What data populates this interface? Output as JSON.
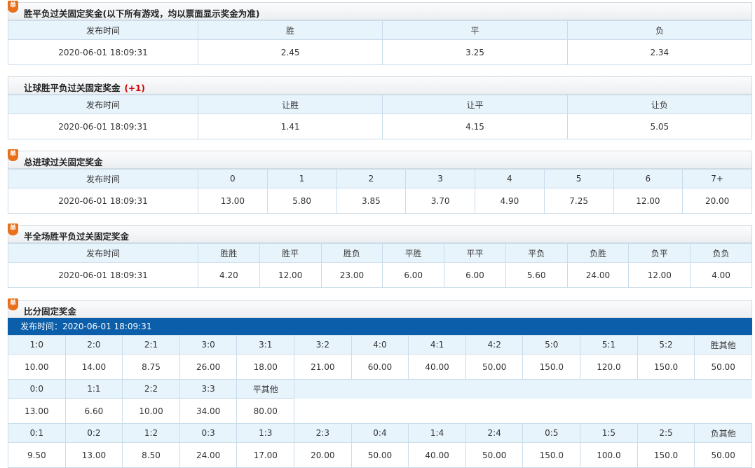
{
  "sections": {
    "s1": {
      "badge": "单",
      "title": "胜平负过关固定奖金(以下所有游戏，均以票面显示奖金为准)",
      "headers": [
        "发布时间",
        "胜",
        "平",
        "负"
      ],
      "values": [
        "2020-06-01 18:09:31",
        "2.45",
        "3.25",
        "2.34"
      ]
    },
    "s2": {
      "title": "让球胜平负过关固定奖金",
      "handicap": "(+1)",
      "headers": [
        "发布时间",
        "让胜",
        "让平",
        "让负"
      ],
      "values": [
        "2020-06-01 18:09:31",
        "1.41",
        "4.15",
        "5.05"
      ]
    },
    "s3": {
      "badge": "单",
      "title": "总进球过关固定奖金",
      "headers": [
        "发布时间",
        "0",
        "1",
        "2",
        "3",
        "4",
        "5",
        "6",
        "7+"
      ],
      "values": [
        "2020-06-01 18:09:31",
        "13.00",
        "5.80",
        "3.85",
        "3.70",
        "4.90",
        "7.25",
        "12.00",
        "20.00"
      ]
    },
    "s4": {
      "badge": "单",
      "title": "半全场胜平负过关固定奖金",
      "headers": [
        "发布时间",
        "胜胜",
        "胜平",
        "胜负",
        "平胜",
        "平平",
        "平负",
        "负胜",
        "负平",
        "负负"
      ],
      "values": [
        "2020-06-01 18:09:31",
        "4.20",
        "12.00",
        "23.00",
        "6.00",
        "6.00",
        "5.60",
        "24.00",
        "12.00",
        "4.00"
      ]
    },
    "s5": {
      "badge": "单",
      "title": "比分固定奖金",
      "publish": "发布时间：2020-06-01 18:09:31",
      "win_h": [
        "1:0",
        "2:0",
        "2:1",
        "3:0",
        "3:1",
        "3:2",
        "4:0",
        "4:1",
        "4:2",
        "5:0",
        "5:1",
        "5:2",
        "胜其他"
      ],
      "win_v": [
        "10.00",
        "14.00",
        "8.75",
        "26.00",
        "18.00",
        "21.00",
        "60.00",
        "40.00",
        "50.00",
        "150.0",
        "120.0",
        "150.0",
        "50.00"
      ],
      "draw_h": [
        "0:0",
        "1:1",
        "2:2",
        "3:3",
        "平其他"
      ],
      "draw_v": [
        "13.00",
        "6.60",
        "10.00",
        "34.00",
        "80.00"
      ],
      "loss_h": [
        "0:1",
        "0:2",
        "1:2",
        "0:3",
        "1:3",
        "2:3",
        "0:4",
        "1:4",
        "2:4",
        "0:5",
        "1:5",
        "2:5",
        "负其他"
      ],
      "loss_v": [
        "9.50",
        "13.00",
        "8.50",
        "24.00",
        "17.00",
        "20.00",
        "50.00",
        "40.00",
        "50.00",
        "150.0",
        "100.0",
        "150.0",
        "50.00"
      ]
    }
  }
}
